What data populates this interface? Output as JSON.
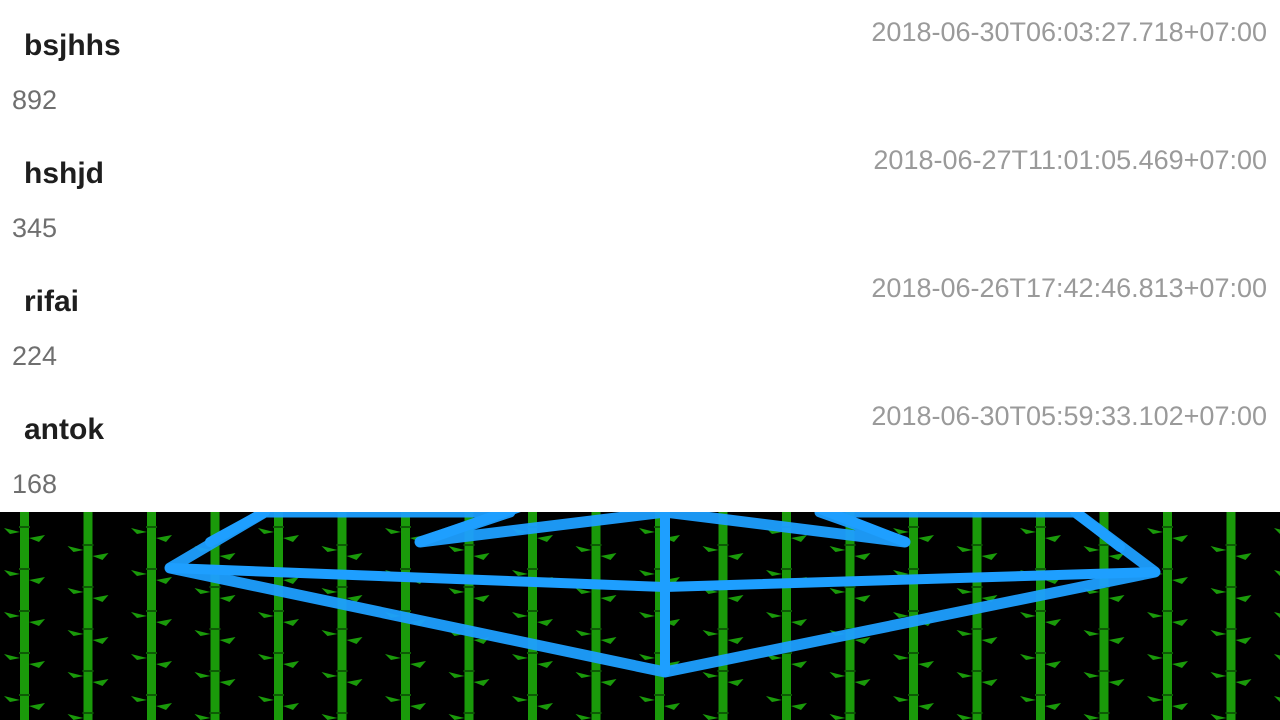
{
  "leaderboard": {
    "entries": [
      {
        "name": "bsjhhs",
        "score": "892",
        "time": "2018-06-30T06:03:27.718+07:00"
      },
      {
        "name": "hshjd",
        "score": "345",
        "time": "2018-06-27T11:01:05.469+07:00"
      },
      {
        "name": "rifai",
        "score": "224",
        "time": "2018-06-26T17:42:46.813+07:00"
      },
      {
        "name": "antok",
        "score": "168",
        "time": "2018-06-30T05:59:33.102+07:00"
      }
    ]
  },
  "scene": {
    "background_color": "#000000",
    "bamboo_color": "#1a9a0a",
    "wireframe_color": "#1e9fff"
  }
}
